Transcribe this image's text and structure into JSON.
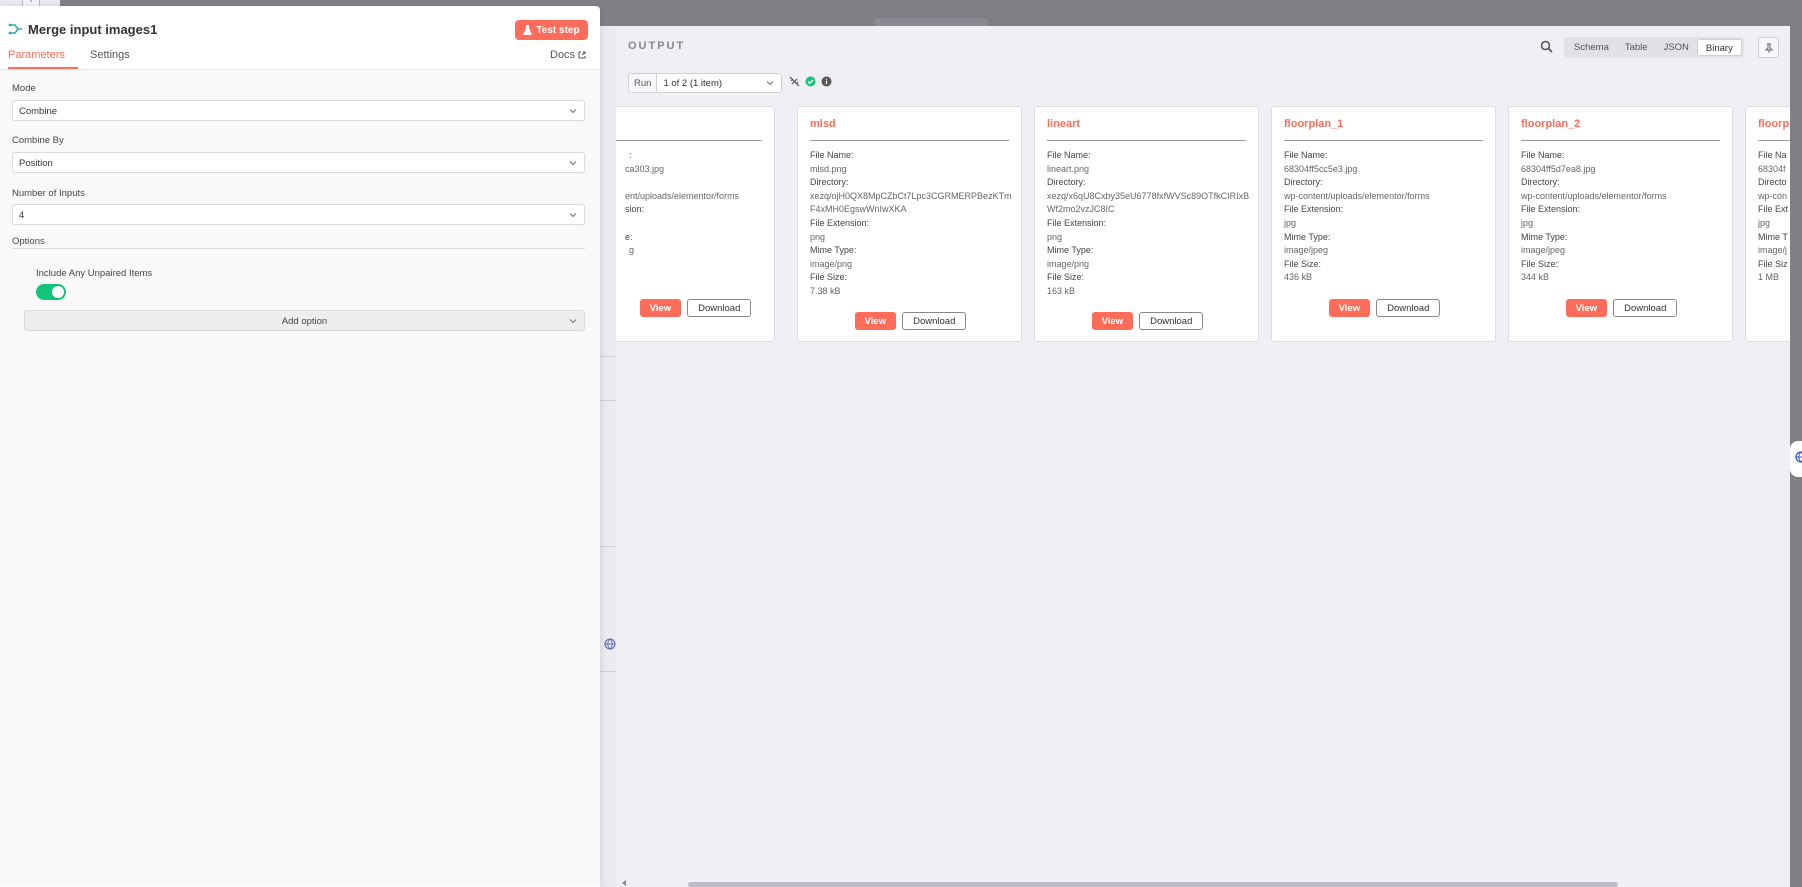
{
  "node": {
    "title": "Merge input images1",
    "test_step_label": "Test step",
    "tabs": [
      {
        "label": "Parameters",
        "active": true
      },
      {
        "label": "Settings",
        "active": false
      }
    ],
    "docs_label": "Docs"
  },
  "parameters": {
    "mode": {
      "label": "Mode",
      "value": "Combine"
    },
    "combine_by": {
      "label": "Combine By",
      "value": "Position"
    },
    "number_of_inputs": {
      "label": "Number of Inputs",
      "value": "4"
    },
    "options_label": "Options",
    "include_unpaired": {
      "label": "Include Any Unpaired Items",
      "enabled": true
    },
    "add_option_label": "Add option"
  },
  "output": {
    "title": "OUTPUT",
    "views": [
      {
        "label": "Schema",
        "active": false
      },
      {
        "label": "Table",
        "active": false
      },
      {
        "label": "JSON",
        "active": false
      },
      {
        "label": "Binary",
        "active": true
      }
    ],
    "run_label": "Run",
    "run_selected": "1 of 2 (1 item)",
    "field_labels": {
      "file_name": "File Name:",
      "directory": "Directory:",
      "file_extension": "File Extension:",
      "mime_type": "Mime Type:",
      "file_size": "File Size:"
    },
    "view_label": "View",
    "download_label": "Download",
    "cards": [
      {
        "title": "",
        "file_name": "ca303.jpg",
        "directory": "ent/uploads/elementor/forms",
        "file_extension": "",
        "mime_type": "g",
        "file_size": "",
        "fl_file_name": "",
        "fl_directory": "",
        "fl_file_extension": "sion:",
        "fl_mime_type": "e:",
        "fl_file_size": ""
      },
      {
        "title": "mlsd",
        "file_name": "mlsd.png",
        "directory": "xezq/ojH0QX8MpCZbCt7Lpc3CGRMERPBezKTmF4xMH0EgswWnIwXKA",
        "file_extension": "png",
        "mime_type": "image/png",
        "file_size": "7.38 kB"
      },
      {
        "title": "lineart",
        "file_name": "lineart.png",
        "directory": "xezq/x6qU8Cxby35eU6778fxfWVSc89OTfkCIRIxBWf2mo2vzJC8IC",
        "file_extension": "png",
        "mime_type": "image/png",
        "file_size": "163 kB"
      },
      {
        "title": "floorplan_1",
        "file_name": "68304ff5cc5e3.jpg",
        "directory": "wp-content/uploads/elementor/forms",
        "file_extension": "jpg",
        "mime_type": "image/jpeg",
        "file_size": "436 kB"
      },
      {
        "title": "floorplan_2",
        "file_name": "68304ff5d7ea8.jpg",
        "directory": "wp-content/uploads/elementor/forms",
        "file_extension": "jpg",
        "mime_type": "image/jpeg",
        "file_size": "344 kB"
      },
      {
        "title": "floorpl",
        "file_name": "68304f",
        "directory": "wp-con",
        "file_extension": "jpg",
        "mime_type": "image/j",
        "file_size": "1 MB",
        "fl_file_name": "File Na",
        "fl_directory": "Directo",
        "fl_file_extension": "File Ext",
        "fl_mime_type": "Mime T",
        "fl_file_size": "File Siz"
      }
    ]
  },
  "colors": {
    "accent": "#ff6d5a",
    "toggle_on": "#13c47b",
    "success": "#13c47b"
  }
}
